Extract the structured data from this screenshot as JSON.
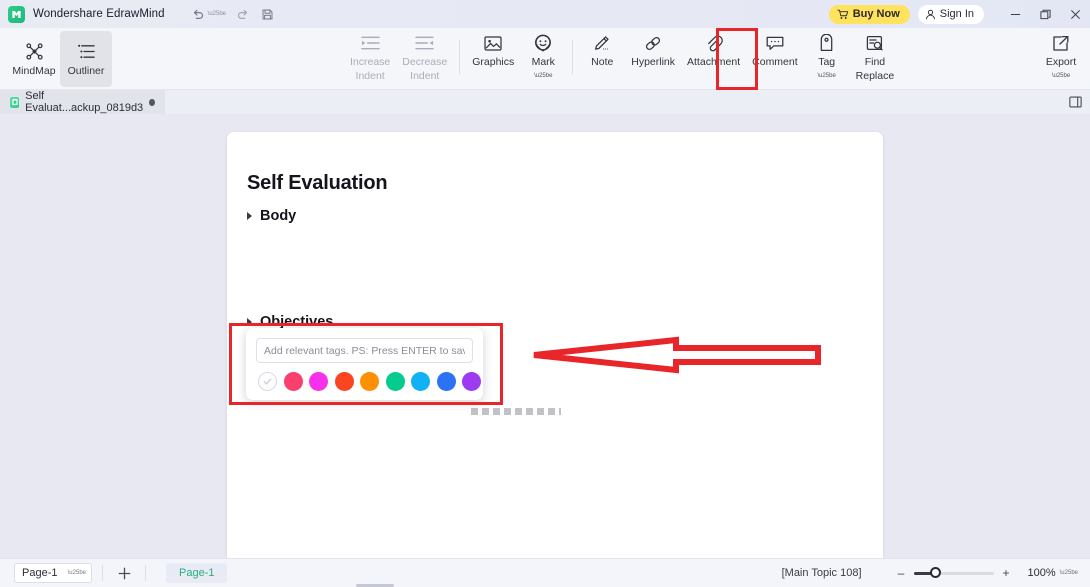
{
  "app": {
    "logo_icon": "edrawmind-logo-icon",
    "title": "Wondershare EdrawMind",
    "undo_icon": "undo-icon",
    "redo_icon": "redo-icon",
    "save_icon": "save-icon",
    "buy_now": "Buy Now",
    "cart_icon": "cart-icon",
    "sign_in": "Sign In",
    "person_icon": "person-icon",
    "minimize": "–",
    "maximize": "❐",
    "close": "✕"
  },
  "ribbon": {
    "left_items": [
      {
        "label": "MindMap",
        "icon": "mindmap-icon",
        "active": false
      },
      {
        "label": "Outliner",
        "icon": "outliner-icon",
        "active": true
      }
    ],
    "center_items": [
      {
        "label": "Increase\nIndent",
        "line1": "Increase",
        "line2": "Indent",
        "icon": "increase-indent-icon",
        "disabled": true,
        "caret": false
      },
      {
        "label": "Decrease\nIndent",
        "line1": "Decrease",
        "line2": "Indent",
        "icon": "decrease-indent-icon",
        "disabled": true,
        "caret": false
      },
      {
        "label": "Graphics",
        "line1": "Graphics",
        "line2": "",
        "icon": "graphics-icon",
        "disabled": false,
        "caret": false
      },
      {
        "label": "Mark",
        "line1": "Mark",
        "line2": "",
        "icon": "mark-icon",
        "disabled": false,
        "caret": true
      },
      {
        "label": "Note",
        "line1": "Note",
        "line2": "",
        "icon": "note-icon",
        "disabled": false,
        "caret": false
      },
      {
        "label": "Hyperlink",
        "line1": "Hyperlink",
        "line2": "",
        "icon": "hyperlink-icon",
        "disabled": false,
        "caret": false
      },
      {
        "label": "Attachment",
        "line1": "Attachment",
        "line2": "",
        "icon": "attachment-icon",
        "disabled": false,
        "caret": false
      },
      {
        "label": "Comment",
        "line1": "Comment",
        "line2": "",
        "icon": "comment-icon",
        "disabled": false,
        "caret": false
      },
      {
        "label": "Tag",
        "line1": "Tag",
        "line2": "",
        "icon": "tag-icon",
        "disabled": false,
        "caret": true
      },
      {
        "label": "Find Replace",
        "line1": "Find",
        "line2": "Replace",
        "icon": "find-replace-icon",
        "disabled": false,
        "caret": false
      }
    ],
    "export": {
      "label": "Export",
      "icon": "export-icon",
      "caret": true
    }
  },
  "doc_tab": {
    "label": "Self Evaluat...ackup_0819d3",
    "file_icon": "document-icon",
    "modified_dot": "●",
    "panel_toggle_icon": "panel-toggle-icon"
  },
  "document": {
    "title": "Self Evaluation",
    "rows": [
      {
        "label": "Body"
      },
      {
        "label": "Objectives"
      }
    ]
  },
  "tag_popup": {
    "placeholder": "Add relevant tags. PS: Press ENTER to save your tag.",
    "value": "",
    "no_color_icon": "checkmark-icon",
    "colors": [
      {
        "name": "none",
        "hex": "#fdfdfd"
      },
      {
        "name": "pink",
        "hex": "#fa3e6e"
      },
      {
        "name": "magenta",
        "hex": "#f730ec"
      },
      {
        "name": "red",
        "hex": "#fa4620"
      },
      {
        "name": "orange",
        "hex": "#fd9000"
      },
      {
        "name": "green",
        "hex": "#05cb8f"
      },
      {
        "name": "cyan",
        "hex": "#11b1f5"
      },
      {
        "name": "blue",
        "hex": "#2c72f5"
      },
      {
        "name": "purple",
        "hex": "#9c3bf0"
      }
    ]
  },
  "annotations": {
    "highlight_color": "#e8262a",
    "arrow_name": "red-arrow-pointing-to-tag-popup"
  },
  "statusbar": {
    "page_select_value": "Page-1",
    "add_page_icon": "plus-icon",
    "page_chip": "Page-1",
    "topic_info": "[Main Topic 108]",
    "zoom_out": "–",
    "zoom_in": "+",
    "zoom_level": "100%",
    "zoom_caret": "▾"
  }
}
